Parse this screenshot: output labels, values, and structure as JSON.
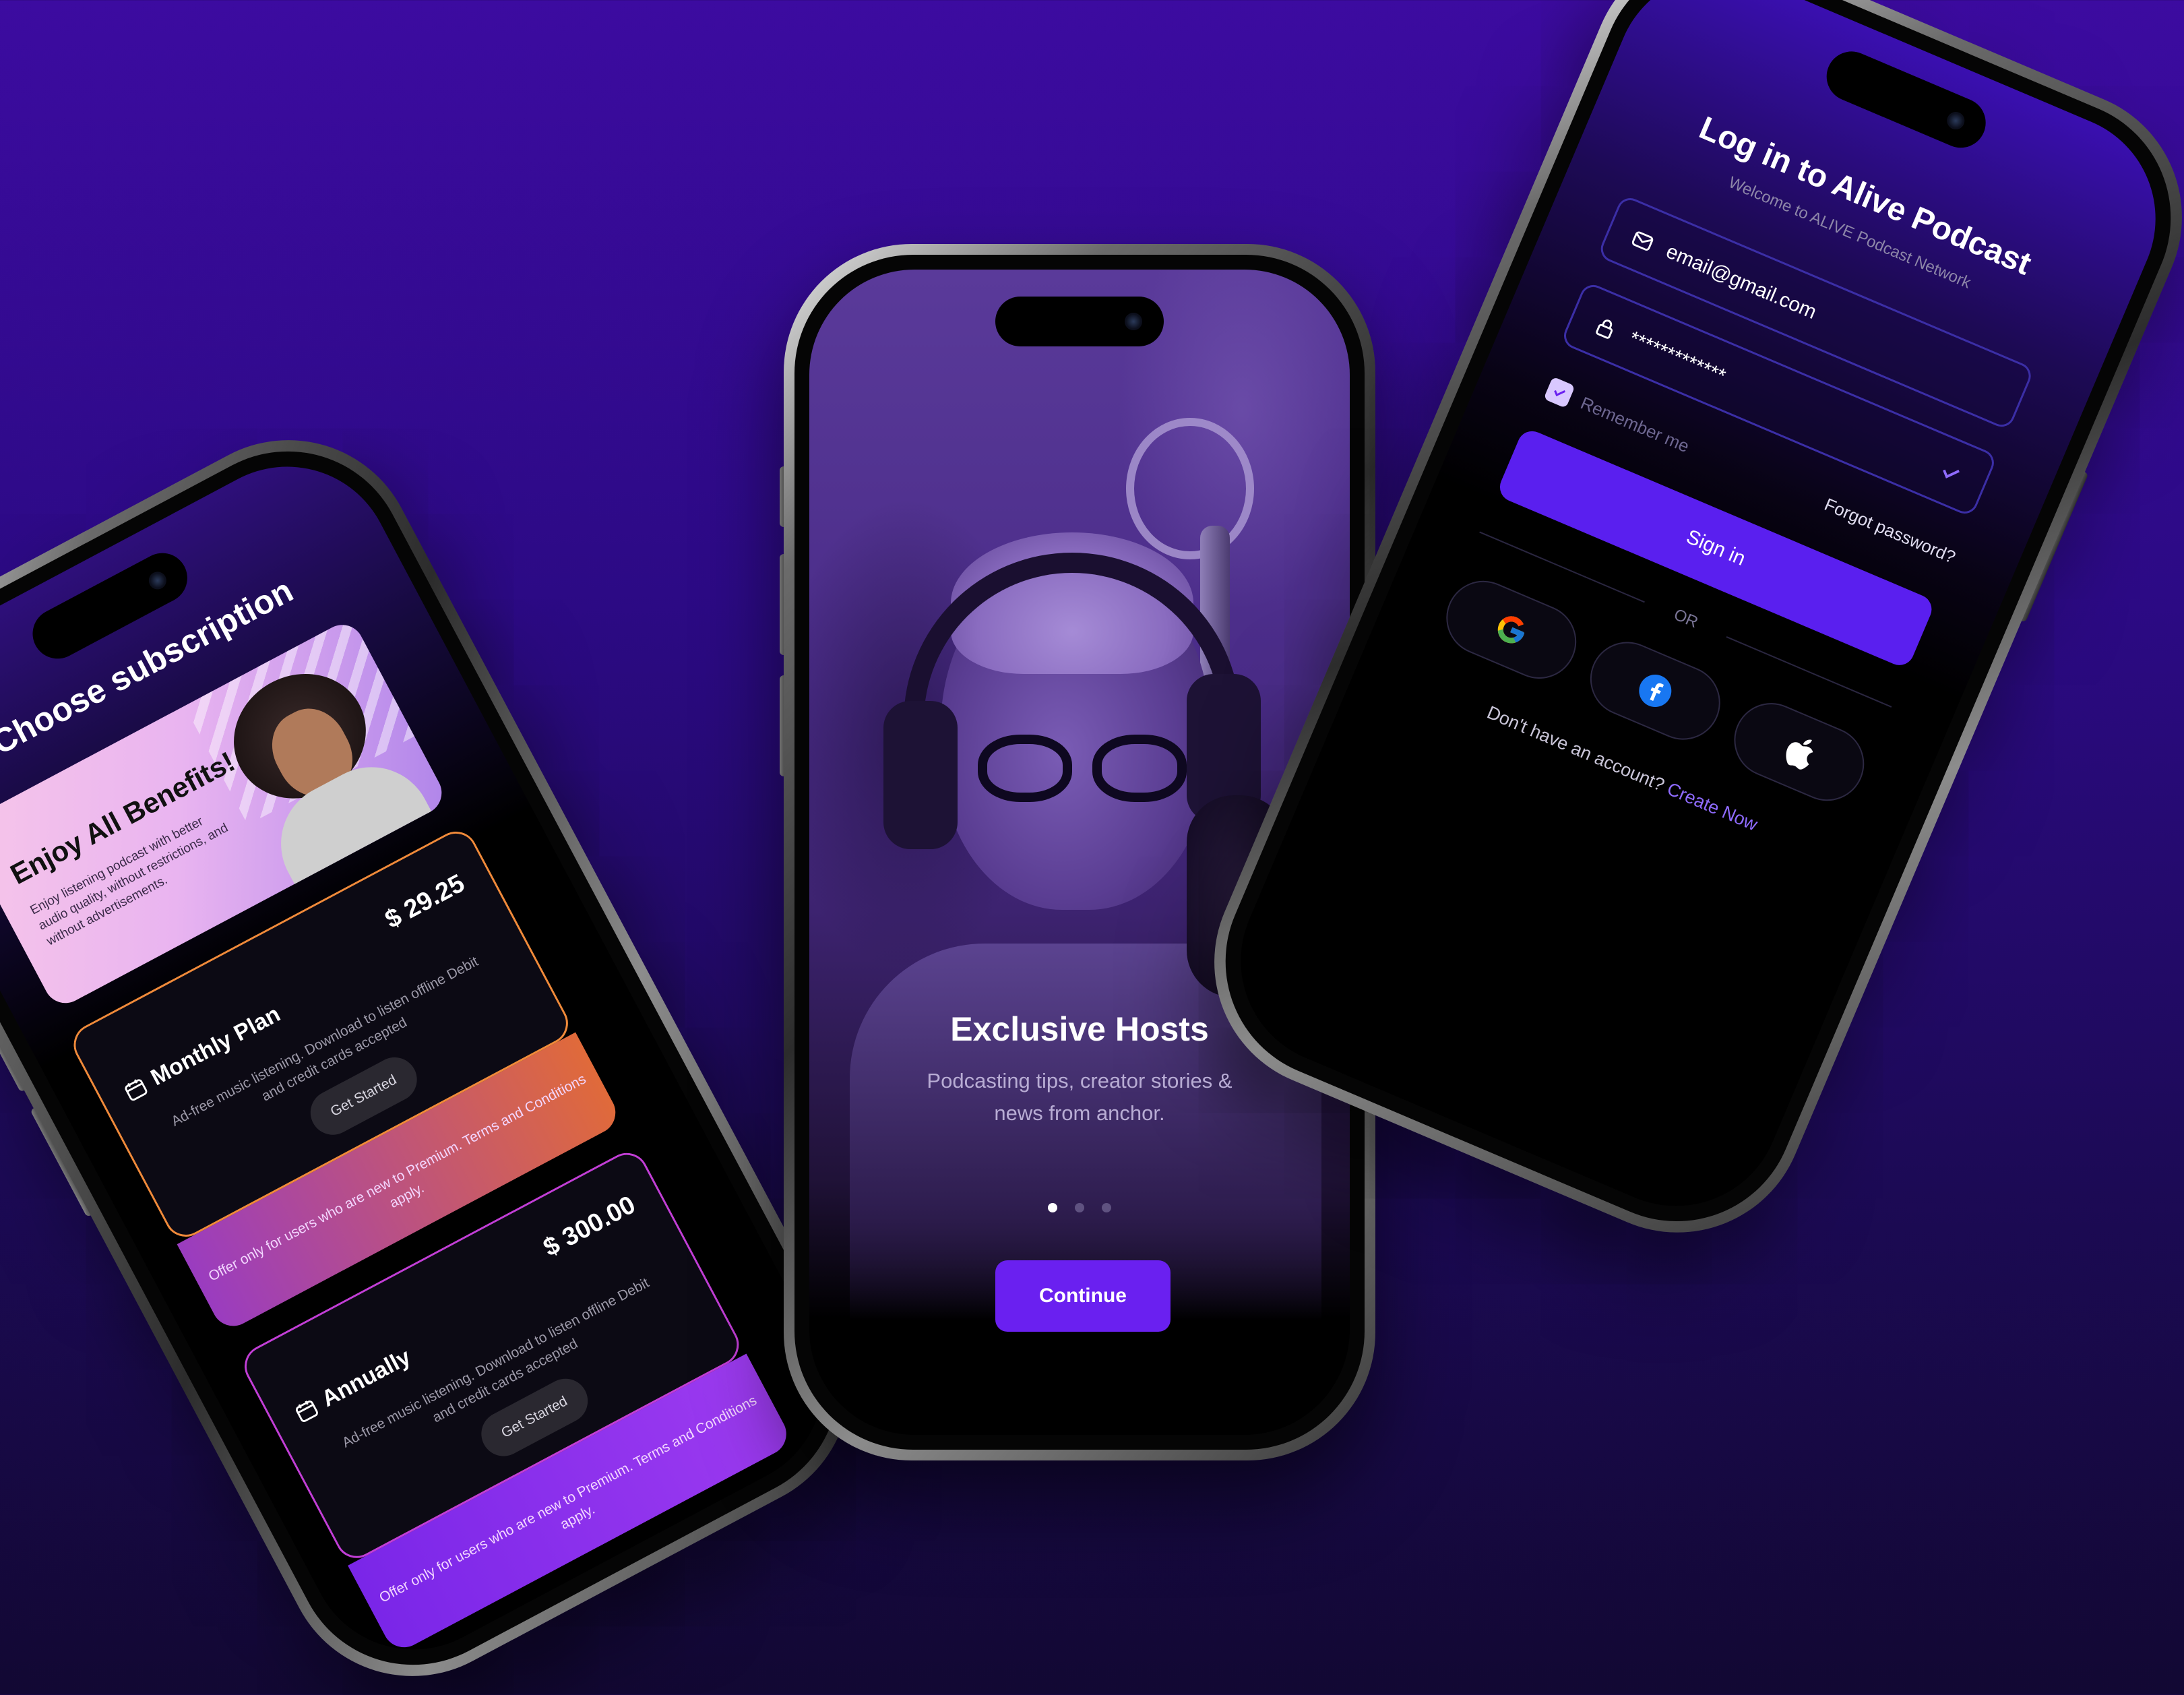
{
  "subscription": {
    "title": "Choose subscription",
    "benefits": {
      "title": "Enjoy All Benefits!",
      "description": "Enjoy listening podcast with better audio quality, without restrictions, and without advertisements."
    },
    "plans": [
      {
        "name": "Monthly Plan",
        "price": "$ 29.25",
        "description": "Ad-free music listening. Download to listen offline Debit and credit cards accepted",
        "button": "Get Started",
        "footer": "Offer only for users who are new to Premium. Terms and Conditions apply."
      },
      {
        "name": "Annually",
        "price": "$ 300.00",
        "description": "Ad-free music listening. Download to listen offline Debit and credit cards accepted",
        "button": "Get Started",
        "footer": "Offer only for users who are new to Premium. Terms and Conditions apply."
      }
    ]
  },
  "onboarding": {
    "title": "Exclusive Hosts",
    "subtitle": "Podcasting tips, creator stories & news from anchor.",
    "continue": "Continue",
    "page_count": 3,
    "active_page": 1
  },
  "login": {
    "title": "Log in to Alive Podcast",
    "subtitle": "Welcome to ALIVE Podcast Network",
    "email_value": "email@gmail.com",
    "password_value": "*************",
    "remember": "Remember me",
    "forgot": "Forgot password?",
    "signin": "Sign in",
    "or": "OR",
    "signup_prompt": "Don't have an account?",
    "signup_link": "Create Now"
  },
  "colors": {
    "accent": "#6a20f0",
    "background": "#2c0a85"
  }
}
